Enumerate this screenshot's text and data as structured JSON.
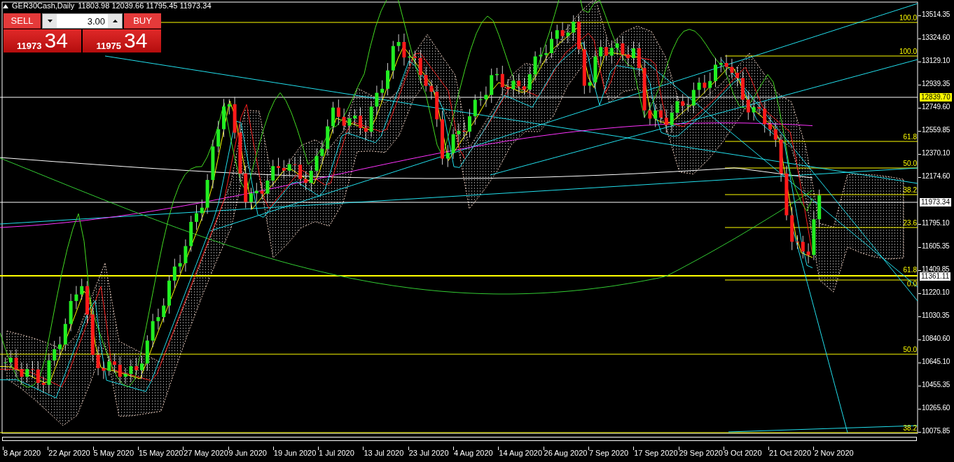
{
  "chart_header": {
    "symbol": "GER30Cash,Daily",
    "ohlc": "11803.98 12039.66 11795.45 11973.34"
  },
  "trade_panel": {
    "sell_label": "SELL",
    "buy_label": "BUY",
    "lot": "3.00",
    "sell_price": {
      "base": "11973",
      "big": "34"
    },
    "buy_price": {
      "base": "11975",
      "big": "34"
    }
  },
  "fib_labels": [
    "100.0",
    "100.0",
    "61.8",
    "50.0",
    "38.2",
    "23.6",
    "61.8",
    "0.0",
    "50.0",
    "38.2"
  ],
  "price_tags": [
    {
      "kind": "level",
      "text": "12839.70"
    },
    {
      "kind": "current",
      "text": "11973.34"
    },
    {
      "kind": "current",
      "text": "11361.11"
    }
  ],
  "y_axis": [
    "13514.35",
    "13324.60",
    "13129.10",
    "12939.35",
    "12749.60",
    "12559.85",
    "12370.10",
    "12174.60",
    "11795.10",
    "11605.35",
    "11409.85",
    "11220.10",
    "11030.35",
    "10840.60",
    "10645.10",
    "10455.35",
    "10265.60",
    "10075.85"
  ],
  "x_axis": [
    "8 Apr 2020",
    "22 Apr 2020",
    "5 May 2020",
    "15 May 2020",
    "27 May 2020",
    "9 Jun 2020",
    "19 Jun 2020",
    "1 Jul 2020",
    "13 Jul 2020",
    "23 Jul 2020",
    "4 Aug 2020",
    "14 Aug 2020",
    "26 Aug 2020",
    "7 Sep 2020",
    "17 Sep 2020",
    "29 Sep 2020",
    "9 Oct 2020",
    "21 Oct 2020",
    "2 Nov 2020"
  ]
}
